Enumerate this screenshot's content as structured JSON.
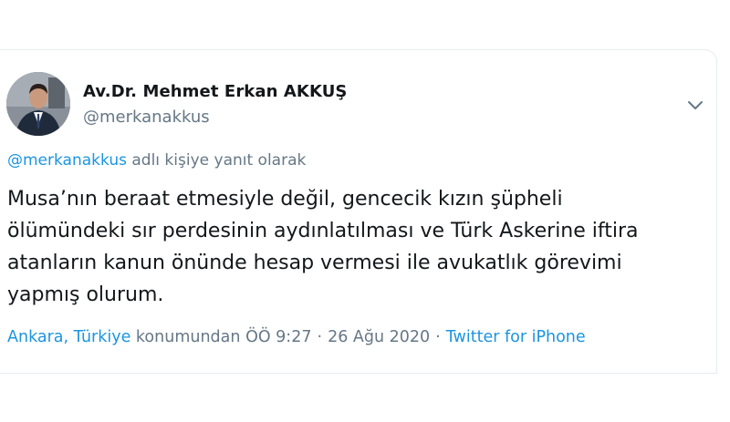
{
  "author": {
    "display_name": "Av.Dr. Mehmet Erkan AKKUŞ",
    "handle": "@merkanakkus"
  },
  "reply": {
    "mention": "@merkanakkus",
    "suffix": " adlı kişiye yanıt olarak"
  },
  "tweet": {
    "text": "Musa’nın beraat etmesiyle değil, gencecik kızın şüpheli\nölümündeki sır perdesinin aydınlatılması ve Türk Askerine iftira\natanların kanun önünde hesap vermesi ile avukatlık görevimi\nyapmış olurum."
  },
  "meta": {
    "location": "Ankara, Türkiye",
    "location_suffix": " konumundan",
    "time": "ÖÖ 9:27",
    "separator": "·",
    "date": "26 Ağu 2020",
    "source": "Twitter for iPhone"
  },
  "icons": {
    "menu": "chevron-down-icon"
  },
  "colors": {
    "accent": "#1b95e0",
    "text": "#14171a",
    "muted": "#657786"
  }
}
